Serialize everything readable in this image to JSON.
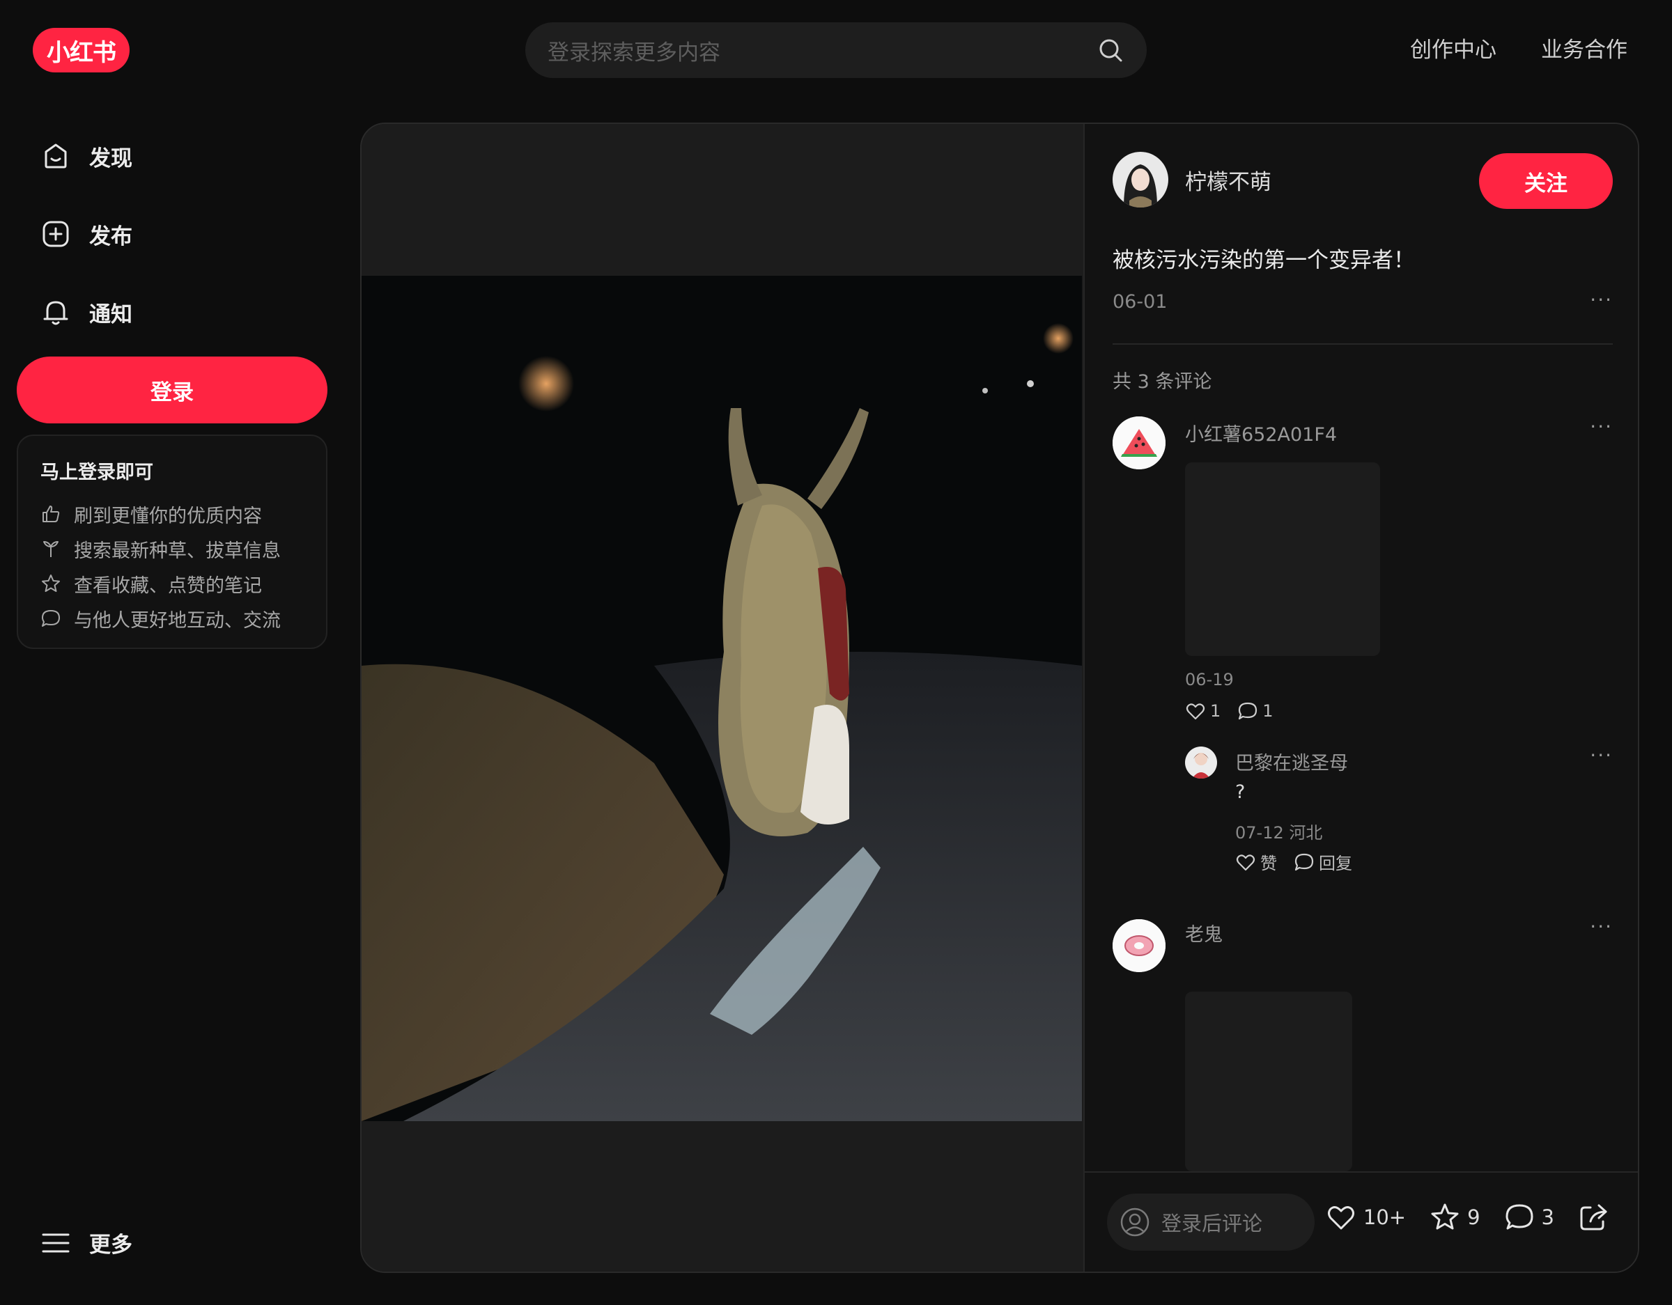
{
  "brand": {
    "logo_text": "小红书",
    "accent": "#ff2442"
  },
  "search": {
    "placeholder": "登录探索更多内容"
  },
  "top_links": [
    "创作中心",
    "业务合作"
  ],
  "sidebar": {
    "items": [
      {
        "label": "发现",
        "icon": "home-icon"
      },
      {
        "label": "发布",
        "icon": "plus-square-icon"
      },
      {
        "label": "通知",
        "icon": "bell-icon"
      }
    ],
    "login_button": "登录",
    "login_card": {
      "title": "马上登录即可",
      "benefits": [
        {
          "icon": "thumbs-up-icon",
          "text": "刷到更懂你的优质内容"
        },
        {
          "icon": "sprout-icon",
          "text": "搜索最新种草、拔草信息"
        },
        {
          "icon": "star-icon",
          "text": "查看收藏、点赞的笔记"
        },
        {
          "icon": "chat-bubble-icon",
          "text": "与他人更好地互动、交流"
        }
      ]
    },
    "more_label": "更多"
  },
  "note": {
    "author": {
      "name": "柠檬不萌"
    },
    "follow_button": "关注",
    "title": "被核污水污染的第一个变异者！",
    "date": "06-01",
    "comment_count_text": "共 3 条评论",
    "comments": [
      {
        "user": "小红薯652A01F4",
        "avatar_icon": "watermelon-icon",
        "date": "06-19",
        "likes": "1",
        "replies": "1",
        "reply": {
          "user": "巴黎在逃圣母",
          "text": "?",
          "meta": "07-12 河北",
          "like_label": "赞",
          "reply_label": "回复"
        }
      },
      {
        "user": "老鬼",
        "avatar_icon": "donut-icon"
      }
    ],
    "bottom": {
      "input_placeholder": "登录后评论",
      "likes": "10+",
      "collects": "9",
      "comments": "3"
    }
  }
}
